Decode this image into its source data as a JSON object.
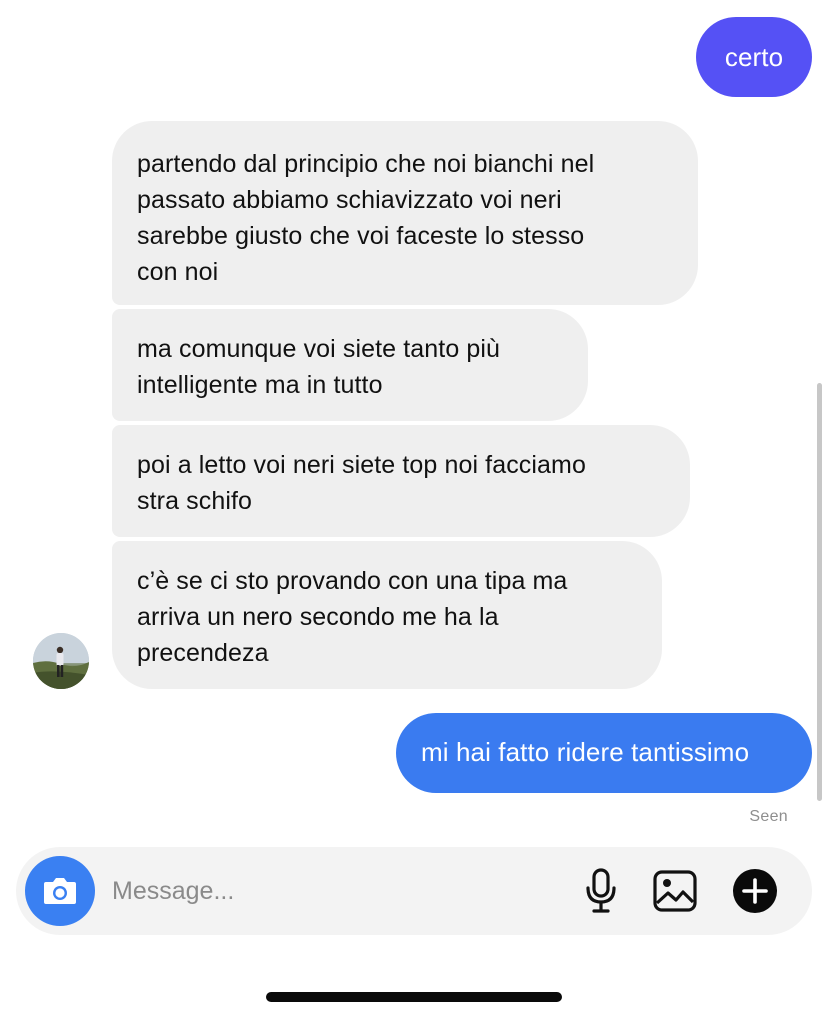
{
  "conversation": {
    "messages": [
      {
        "direction": "sent",
        "text": "certo"
      },
      {
        "direction": "received",
        "text": "partendo dal principio che noi bianchi nel\npassato abbiamo schiavizzato voi neri\nsarebbe giusto che voi faceste lo stesso\ncon noi"
      },
      {
        "direction": "received",
        "text": "ma comunque voi siete tanto più\nintelligente ma in tutto"
      },
      {
        "direction": "received",
        "text": "poi a letto voi neri siete top noi facciamo\nstra schifo"
      },
      {
        "direction": "received",
        "text": "c’è se ci sto provando con una tipa ma\narriva un nero secondo me ha la\nprecendeza"
      },
      {
        "direction": "sent",
        "text": "mi hai fatto ridere tantissimo"
      }
    ],
    "read_receipt": "Seen"
  },
  "composer": {
    "placeholder": "Message...",
    "value": "",
    "icons": [
      "camera-icon",
      "microphone-icon",
      "gallery-icon",
      "plus-icon"
    ]
  },
  "colors": {
    "sent_bubble_first": "#5551f5",
    "sent_bubble_last": "#3a7bf0",
    "received_bubble": "#efefef",
    "camera_button": "#3a80f2"
  }
}
